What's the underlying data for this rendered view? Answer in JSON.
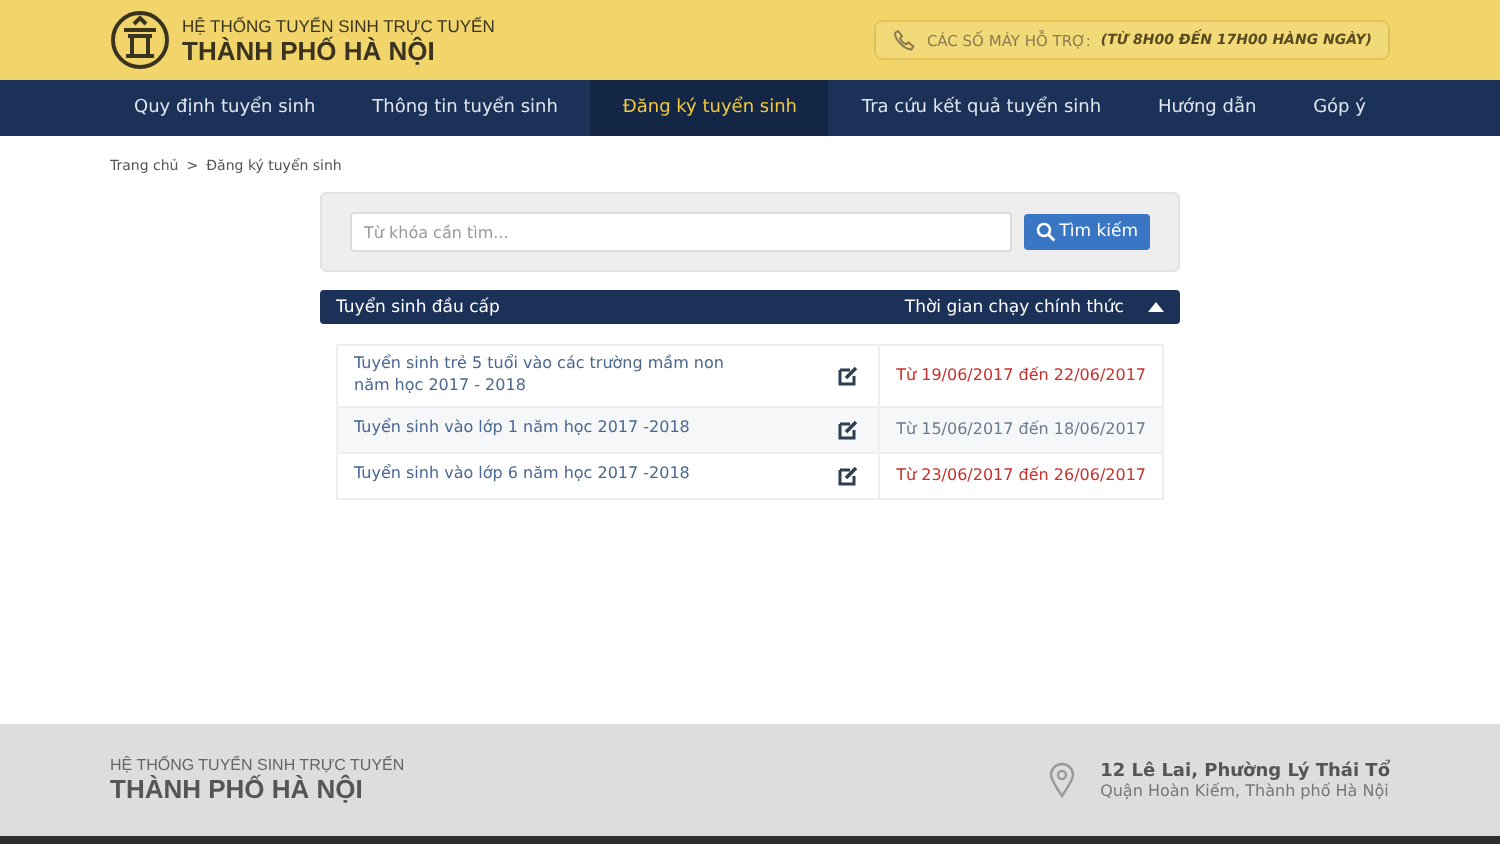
{
  "header": {
    "subtitle": "HỆ THỐNG TUYỂN SINH TRỰC TUYẾN",
    "title": "THÀNH PHỐ HÀ NỘI",
    "support_label": "CÁC SỐ MÁY HỖ TRỢ:",
    "support_hours": "(TỪ 8H00 ĐẾN 17H00 HÀNG NGÀY)"
  },
  "nav": [
    {
      "label": "Quy định tuyển sinh",
      "selected": false
    },
    {
      "label": "Thông tin tuyển sinh",
      "selected": false
    },
    {
      "label": "Đăng ký tuyển sinh",
      "selected": true
    },
    {
      "label": "Tra cứu kết quả tuyển sinh",
      "selected": false
    },
    {
      "label": "Hướng dẫn",
      "selected": false
    },
    {
      "label": "Góp ý",
      "selected": false
    }
  ],
  "breadcrumb": [
    "Trang chủ",
    "Đăng ký tuyển sinh"
  ],
  "breadcrumb_separator": ">",
  "search": {
    "placeholder": "Từ khóa cần tìm...",
    "button": "Tìm kiếm"
  },
  "table": {
    "columns": [
      "Tuyển sinh đầu cấp",
      "Thời gian chạy chính thức"
    ],
    "expanded": true,
    "rows": [
      {
        "name": "Tuyển sinh trẻ 5 tuổi vào các trường mầm non năm học 2017 - 2018",
        "period": "Từ 19/06/2017 đến 22/06/2017",
        "color": "#c9302c"
      },
      {
        "name": "Tuyển sinh vào lớp 1 năm học 2017 -2018",
        "period": "Từ 15/06/2017 đến 18/06/2017",
        "color": "#6b7b90"
      },
      {
        "name": "Tuyển sinh vào lớp 6 năm học 2017 -2018",
        "period": "Từ 23/06/2017 đến 26/06/2017",
        "color": "#c9302c"
      }
    ]
  },
  "footer": {
    "subtitle": "HỆ THỐNG TUYỂN SINH TRỰC TUYẾN",
    "title": "THÀNH PHỐ HÀ NỘI",
    "address": "12 Lê Lai, Phường Lý Thái Tổ",
    "district": "Quận Hoàn Kiếm, Thành phố Hà Nội"
  }
}
